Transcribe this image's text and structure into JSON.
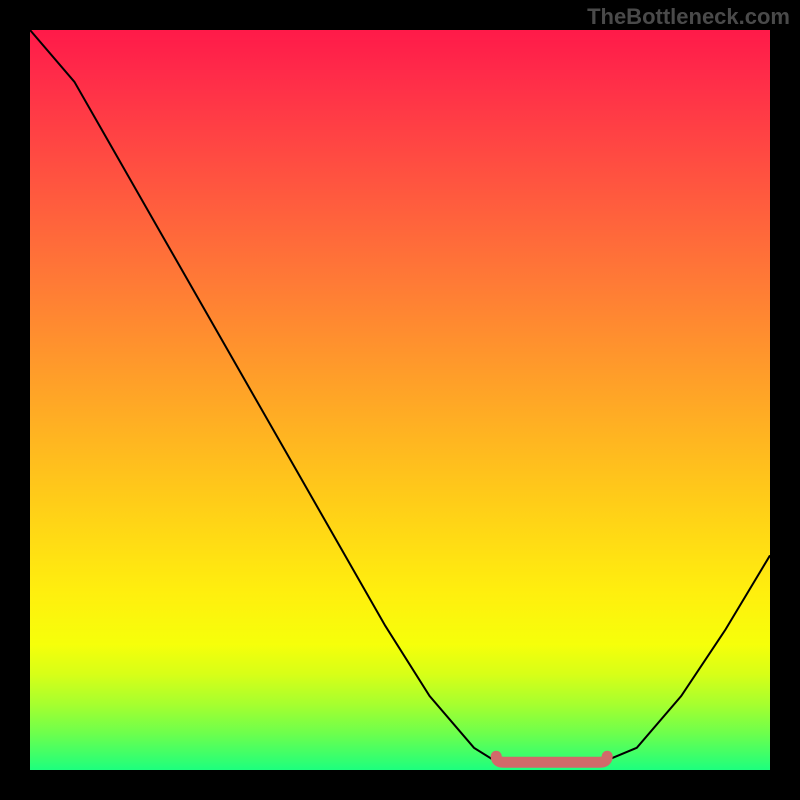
{
  "watermark": "TheBottleneck.com",
  "chart_data": {
    "type": "line",
    "title": "",
    "xlabel": "",
    "ylabel": "",
    "xlim": [
      0,
      100
    ],
    "ylim": [
      0,
      100
    ],
    "note": "Percent-space curve; x across chart width, y=0 bottom, y=100 top.",
    "series": [
      {
        "name": "curve",
        "x": [
          0,
          6,
          12,
          18,
          24,
          30,
          36,
          42,
          48,
          54,
          60,
          64,
          70,
          76,
          82,
          88,
          94,
          100
        ],
        "y": [
          100,
          93,
          82.5,
          72,
          61.5,
          51,
          40.5,
          30,
          19.5,
          10,
          3,
          0.5,
          0.5,
          0.5,
          3,
          10,
          19,
          29
        ]
      },
      {
        "name": "highlight-band",
        "x": [
          63,
          78
        ],
        "y": [
          0.5,
          0.5
        ]
      }
    ],
    "colors": {
      "curve": "#000000",
      "highlight": "#d16a6a",
      "gradient_top": "#ff1a49",
      "gradient_bottom": "#1dff7e",
      "frame_bg": "#000000"
    }
  }
}
